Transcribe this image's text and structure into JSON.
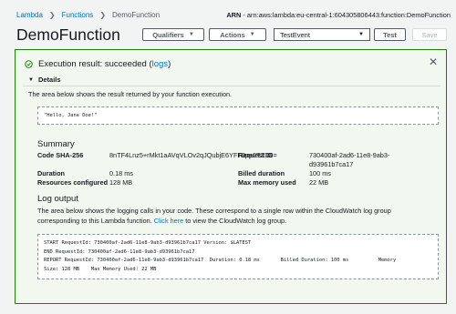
{
  "breadcrumb": {
    "items": [
      "Lambda",
      "Functions"
    ],
    "current": "DemoFunction"
  },
  "arn": {
    "label": "ARN",
    "value": "arn:aws:lambda:eu-central-1:604305806443:function:DemoFunction"
  },
  "page_title": "DemoFunction",
  "toolbar": {
    "qualifiers": "Qualifiers",
    "actions": "Actions",
    "test_event": "TestEvent",
    "test": "Test",
    "save": "Save"
  },
  "result": {
    "heading_prefix": "Execution result: succeeded (",
    "logs_link": "logs",
    "heading_suffix": ")",
    "details_label": "Details",
    "return_desc": "The area below shows the result returned by your function execution.",
    "return_value": "\"Hello, Jane Doe!\""
  },
  "summary": {
    "title": "Summary",
    "code_sha_label": "Code SHA-256",
    "code_sha_value": "8nTF4Lnz5+rMkt1aAVqVLOv2qJQubjE6YFF0pe0TZD8=",
    "request_id_label": "Request ID",
    "request_id_line1": "730400af-2ad6-11e8-9ab3-",
    "request_id_line2": "d93961b7ca17",
    "duration_label": "Duration",
    "duration_value": "0.18 ms",
    "billed_label": "Billed duration",
    "billed_value": "100 ms",
    "resources_label": "Resources configured",
    "resources_value": "128 MB",
    "maxmem_label": "Max memory used",
    "maxmem_value": "22 MB"
  },
  "log_output": {
    "title": "Log output",
    "desc_line1": "The area below shows the logging calls in your code. These correspond to a single row within the CloudWatch log group",
    "desc_line2_prefix": "corresponding to this Lambda function. ",
    "click_here": "Click here",
    "desc_line2_suffix": " to view the CloudWatch log group.",
    "lines": [
      "START RequestId: 730400af-2ad6-11e8-9ab3-d93961b7ca17 Version: $LATEST",
      "END RequestId: 730400af-2ad6-11e8-9ab3-d93961b7ca17",
      "REPORT RequestId: 730400af-2ad6-11e8-9ab3-d93961b7ca17  Duration: 0.18 ms       Billed Duration: 100 ms          Memory",
      "Size: 128 MB    Max Memory Used: 22 MB"
    ]
  },
  "icons": {
    "success": "check-circle-icon",
    "close": "close-icon",
    "caret": "caret-down-icon"
  },
  "colors": {
    "link": "#0073bb",
    "success_border": "#1d8102",
    "success_bg": "#f2f8f0"
  }
}
